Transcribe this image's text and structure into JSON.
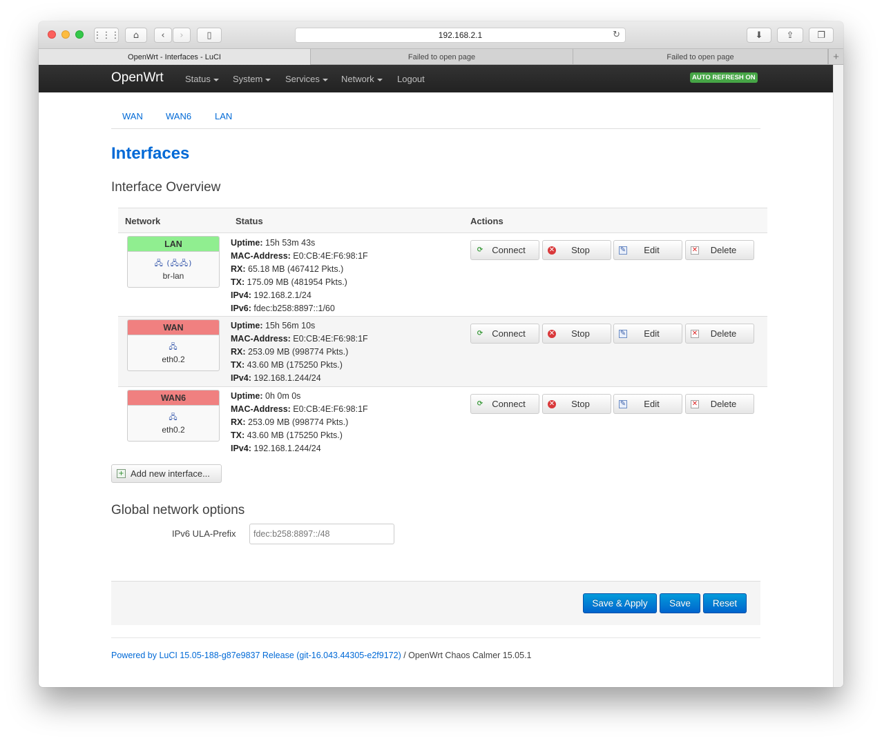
{
  "browser": {
    "url": "192.168.2.1",
    "tabs": [
      "OpenWrt - Interfaces - LuCI",
      "Failed to open page",
      "Failed to open page"
    ],
    "add_tab": "+"
  },
  "navbar": {
    "brand": "OpenWrt",
    "menus": [
      "Status",
      "System",
      "Services",
      "Network",
      "Logout"
    ],
    "auto_refresh": "AUTO REFRESH ON"
  },
  "subtabs": [
    "WAN",
    "WAN6",
    "LAN"
  ],
  "page": {
    "title": "Interfaces",
    "overview_heading": "Interface Overview",
    "global_heading": "Global network options"
  },
  "table": {
    "headers": [
      "Network",
      "Status",
      "Actions"
    ],
    "rows": [
      {
        "name": "LAN",
        "color": "#90ee90",
        "icons": "🖧 (🖧🖧)",
        "device": "br-lan",
        "status": [
          {
            "k": "Uptime:",
            "v": " 15h 53m 43s"
          },
          {
            "k": "MAC-Address:",
            "v": " E0:CB:4E:F6:98:1F"
          },
          {
            "k": "RX:",
            "v": " 65.18 MB (467412 Pkts.)"
          },
          {
            "k": "TX:",
            "v": " 175.09 MB (481954 Pkts.)"
          },
          {
            "k": "IPv4:",
            "v": " 192.168.2.1/24"
          },
          {
            "k": "IPv6:",
            "v": " fdec:b258:8897::1/60"
          }
        ]
      },
      {
        "name": "WAN",
        "color": "#f08080",
        "icons": "🖧",
        "device": "eth0.2",
        "status": [
          {
            "k": "Uptime:",
            "v": " 15h 56m 10s"
          },
          {
            "k": "MAC-Address:",
            "v": " E0:CB:4E:F6:98:1F"
          },
          {
            "k": "RX:",
            "v": " 253.09 MB (998774 Pkts.)"
          },
          {
            "k": "TX:",
            "v": " 43.60 MB (175250 Pkts.)"
          },
          {
            "k": "IPv4:",
            "v": " 192.168.1.244/24"
          }
        ]
      },
      {
        "name": "WAN6",
        "color": "#f08080",
        "icons": "🖧",
        "device": "eth0.2",
        "status": [
          {
            "k": "Uptime:",
            "v": " 0h 0m 0s"
          },
          {
            "k": "MAC-Address:",
            "v": " E0:CB:4E:F6:98:1F"
          },
          {
            "k": "RX:",
            "v": " 253.09 MB (998774 Pkts.)"
          },
          {
            "k": "TX:",
            "v": " 43.60 MB (175250 Pkts.)"
          },
          {
            "k": "IPv4:",
            "v": " 192.168.1.244/24"
          }
        ]
      }
    ],
    "actions": [
      "Connect",
      "Stop",
      "Edit",
      "Delete"
    ]
  },
  "add_interface": "Add new interface...",
  "ula": {
    "label": "IPv6 ULA-Prefix",
    "value": "fdec:b258:8897::/48"
  },
  "buttons": {
    "save_apply": "Save & Apply",
    "save": "Save",
    "reset": "Reset"
  },
  "footer": {
    "link": "Powered by LuCI 15.05-188-g87e9837 Release (git-16.043.44305-e2f9172)",
    "rest": " / OpenWrt Chaos Calmer 15.05.1"
  }
}
